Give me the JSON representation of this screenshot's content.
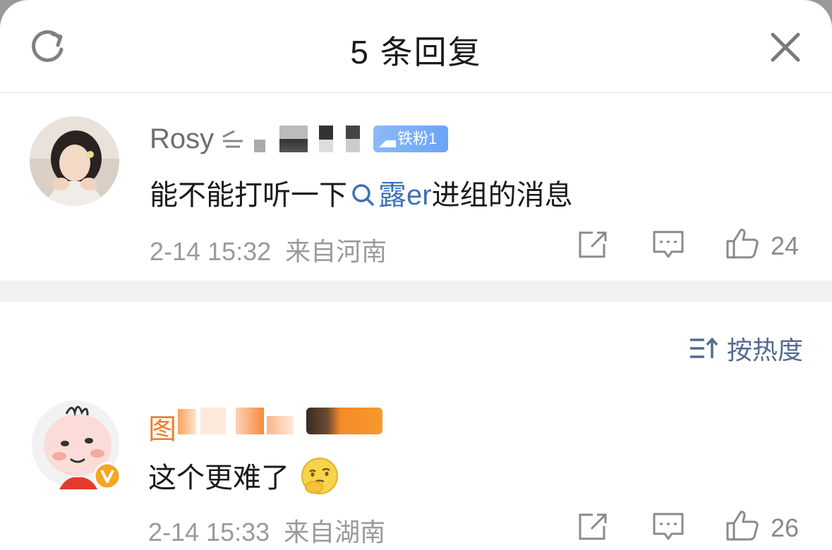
{
  "header": {
    "title": "5 条回复"
  },
  "comment1": {
    "username": "Rosy",
    "badge": "铁粉1",
    "text_prefix": "能不能打听一下",
    "topic": "露er",
    "text_suffix": "进组的消息",
    "time": "2-14 15:32",
    "location": "来自河南",
    "likes": "24"
  },
  "sort": {
    "label": "按热度"
  },
  "comment2": {
    "username": "图",
    "text": "这个更难了",
    "time": "2-14 15:33",
    "location": "来自湖南",
    "likes": "26"
  },
  "colors": {
    "accent": "#3f6fb5",
    "orange_name": "#f07d28",
    "badge_blue": "#6aa4f5",
    "badge_orange": "#f59a2a",
    "verified": "#f5a623"
  }
}
